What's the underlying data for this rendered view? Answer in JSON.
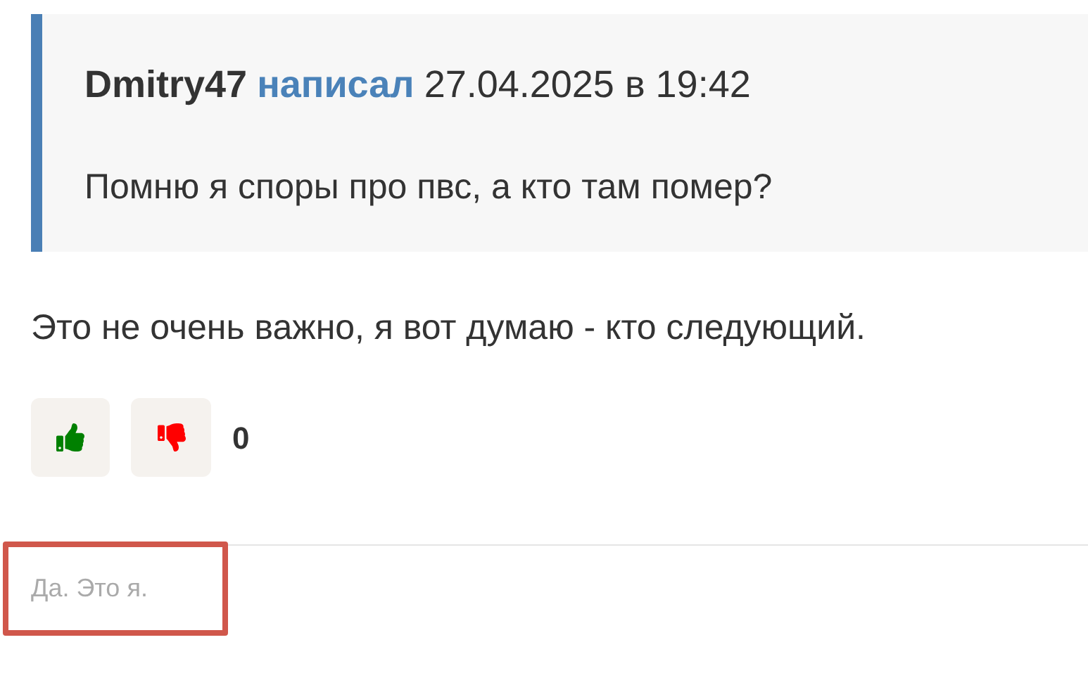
{
  "quote": {
    "author": "Dmitry47",
    "verb": "написал",
    "date": "27.04.2025 в 19:42",
    "text": "Помню я споры про пвс, а кто там помер?"
  },
  "message": "Это не очень важно, я вот думаю - кто следующий.",
  "reactions": {
    "count": "0"
  },
  "signature": "Да. Это я."
}
